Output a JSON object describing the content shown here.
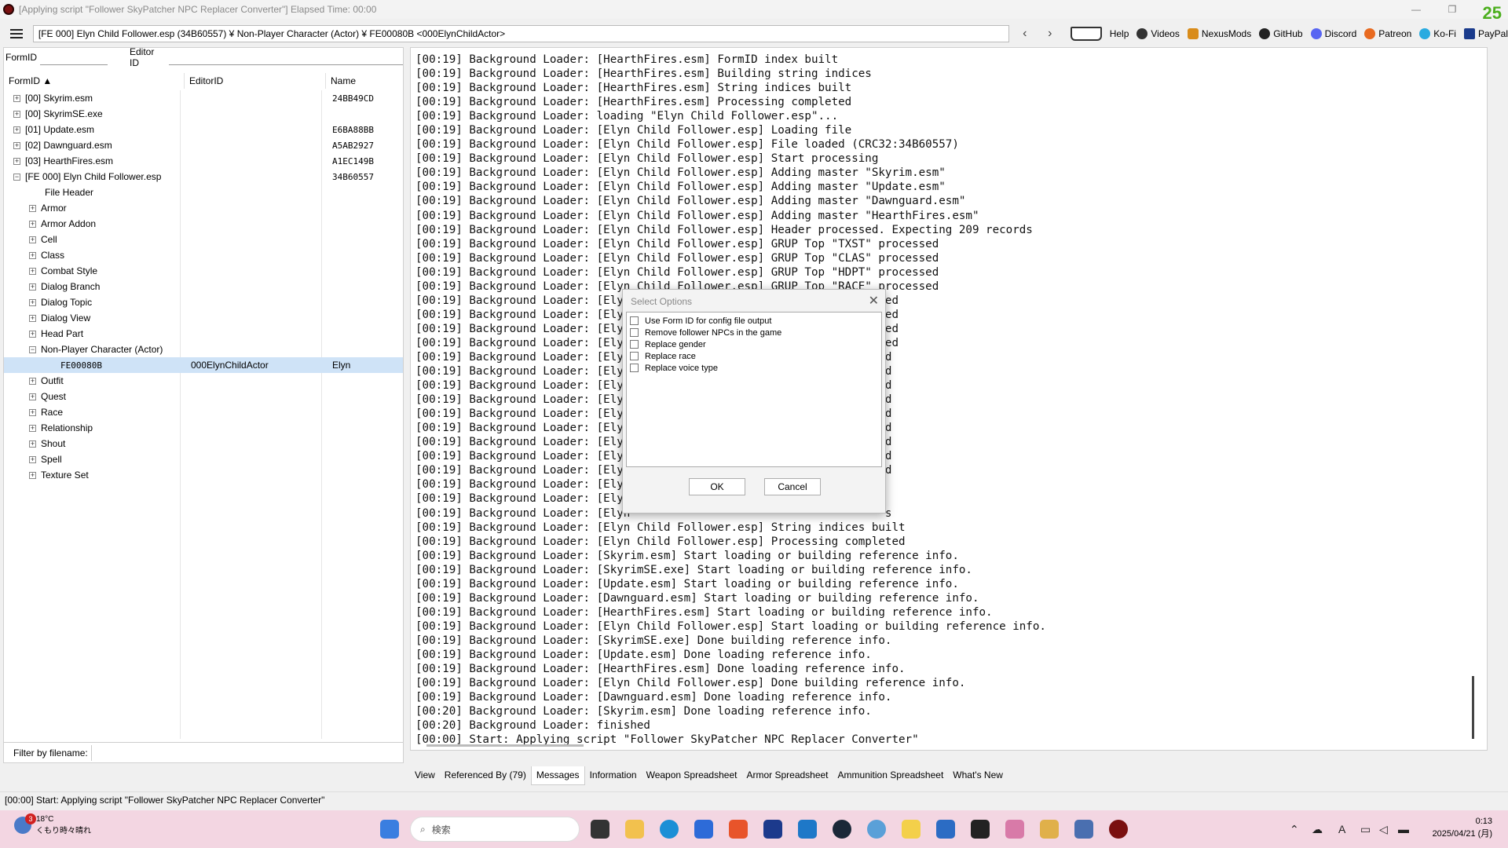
{
  "window": {
    "title": "[Applying script \"Follower SkyPatcher NPC Replacer Converter\"] Elapsed Time: 00:00",
    "corner_badge": "25"
  },
  "toolbar": {
    "path": "[FE 000] Elyn Child Follower.esp (34B60557) ¥ Non-Player Character (Actor) ¥ FE00080B <000ElynChildActor>",
    "back_icon": "‹",
    "forward_icon": "›",
    "links": [
      "Help",
      "Videos",
      "NexusMods",
      "GitHub",
      "Discord",
      "Patreon",
      "Ko-Fi",
      "PayPal"
    ]
  },
  "left": {
    "formid_label": "FormID",
    "editorid_label": "Editor ID",
    "columns": [
      "FormID ▲",
      "EditorID",
      "Name"
    ],
    "files": [
      {
        "label": "[00] Skyrim.esm",
        "value": "24BB49CD"
      },
      {
        "label": "[00] SkyrimSE.exe",
        "value": ""
      },
      {
        "label": "[01] Update.esm",
        "value": "E6BA88BB"
      },
      {
        "label": "[02] Dawnguard.esm",
        "value": "A5AB2927"
      },
      {
        "label": "[03] HearthFires.esm",
        "value": "A1EC149B"
      },
      {
        "label": "[FE 000] Elyn Child Follower.esp",
        "value": "34B60557"
      }
    ],
    "groups": [
      "File Header",
      "Armor",
      "Armor Addon",
      "Cell",
      "Class",
      "Combat Style",
      "Dialog Branch",
      "Dialog Topic",
      "Dialog View",
      "Head Part",
      "Non-Player Character (Actor)"
    ],
    "selected": {
      "formid": "FE00080B",
      "editorid": "000ElynChildActor",
      "name": "Elyn"
    },
    "groups_after": [
      "Outfit",
      "Quest",
      "Race",
      "Relationship",
      "Shout",
      "Spell",
      "Texture Set"
    ],
    "filter_label": "Filter by filename:"
  },
  "log_lines": [
    "[00:19] Background Loader: [HearthFires.esm] FormID index built",
    "[00:19] Background Loader: [HearthFires.esm] Building string indices",
    "[00:19] Background Loader: [HearthFires.esm] String indices built",
    "[00:19] Background Loader: [HearthFires.esm] Processing completed",
    "[00:19] Background Loader: loading \"Elyn Child Follower.esp\"...",
    "[00:19] Background Loader: [Elyn Child Follower.esp] Loading file",
    "[00:19] Background Loader: [Elyn Child Follower.esp] File loaded (CRC32:34B60557)",
    "[00:19] Background Loader: [Elyn Child Follower.esp] Start processing",
    "[00:19] Background Loader: [Elyn Child Follower.esp] Adding master \"Skyrim.esm\"",
    "[00:19] Background Loader: [Elyn Child Follower.esp] Adding master \"Update.esm\"",
    "[00:19] Background Loader: [Elyn Child Follower.esp] Adding master \"Dawnguard.esm\"",
    "[00:19] Background Loader: [Elyn Child Follower.esp] Adding master \"HearthFires.esm\"",
    "[00:19] Background Loader: [Elyn Child Follower.esp] Header processed. Expecting 209 records",
    "[00:19] Background Loader: [Elyn Child Follower.esp] GRUP Top \"TXST\" processed",
    "[00:19] Background Loader: [Elyn Child Follower.esp] GRUP Top \"CLAS\" processed",
    "[00:19] Background Loader: [Elyn Child Follower.esp] GRUP Top \"HDPT\" processed",
    "[00:19] Background Loader: [Elyn Child Follower.esp] GRUP Top \"RACE\" processed",
    "[00:19] Background Loader: [Elyn                                     sed",
    "[00:19] Background Loader: [Elyn                                     sed",
    "[00:19] Background Loader: [Elyn                                     sed",
    "[00:19] Background Loader: [Elyn                                     sed",
    "[00:19] Background Loader: [Elyn                                     ed",
    "[00:19] Background Loader: [Elyn                                     ed",
    "[00:19] Background Loader: [Elyn                                     ed",
    "[00:19] Background Loader: [Elyn                                     ed",
    "[00:19] Background Loader: [Elyn                                     ed",
    "[00:19] Background Loader: [Elyn                                     ed",
    "[00:19] Background Loader: [Elyn                                     ed",
    "[00:19] Background Loader: [Elyn                                     ed",
    "[00:19] Background Loader: [Elyn                                     ed",
    "[00:19] Background Loader: [Elyn",
    "[00:19] Background Loader: [Elyn",
    "[00:19] Background Loader: [Elyn                                      s",
    "[00:19] Background Loader: [Elyn Child Follower.esp] String indices built",
    "[00:19] Background Loader: [Elyn Child Follower.esp] Processing completed",
    "[00:19] Background Loader: [Skyrim.esm] Start loading or building reference info.",
    "[00:19] Background Loader: [SkyrimSE.exe] Start loading or building reference info.",
    "[00:19] Background Loader: [Update.esm] Start loading or building reference info.",
    "[00:19] Background Loader: [Dawnguard.esm] Start loading or building reference info.",
    "[00:19] Background Loader: [HearthFires.esm] Start loading or building reference info.",
    "[00:19] Background Loader: [Elyn Child Follower.esp] Start loading or building reference info.",
    "[00:19] Background Loader: [SkyrimSE.exe] Done building reference info.",
    "[00:19] Background Loader: [Update.esm] Done loading reference info.",
    "[00:19] Background Loader: [HearthFires.esm] Done loading reference info.",
    "[00:19] Background Loader: [Elyn Child Follower.esp] Done building reference info.",
    "[00:19] Background Loader: [Dawnguard.esm] Done loading reference info.",
    "[00:20] Background Loader: [Skyrim.esm] Done loading reference info.",
    "[00:20] Background Loader: finished",
    "[00:00] Start: Applying script \"Follower SkyPatcher NPC Replacer Converter\""
  ],
  "tabs": [
    "View",
    "Referenced By (79)",
    "Messages",
    "Information",
    "Weapon Spreadsheet",
    "Armor Spreadsheet",
    "Ammunition Spreadsheet",
    "What's New"
  ],
  "active_tab": "Messages",
  "status": "[00:00] Start: Applying script \"Follower SkyPatcher NPC Replacer Converter\"",
  "dialog": {
    "title": "Select Options",
    "options": [
      "Use Form ID for config file output",
      "Remove follower NPCs in the game",
      "Replace gender",
      "Replace race",
      "Replace voice type"
    ],
    "ok": "OK",
    "cancel": "Cancel"
  },
  "taskbar": {
    "temp": "18°C",
    "weather": "くもり時々晴れ",
    "badge": "3",
    "search_placeholder": "検索",
    "time": "0:13",
    "date": "2025/04/21 (月)"
  }
}
